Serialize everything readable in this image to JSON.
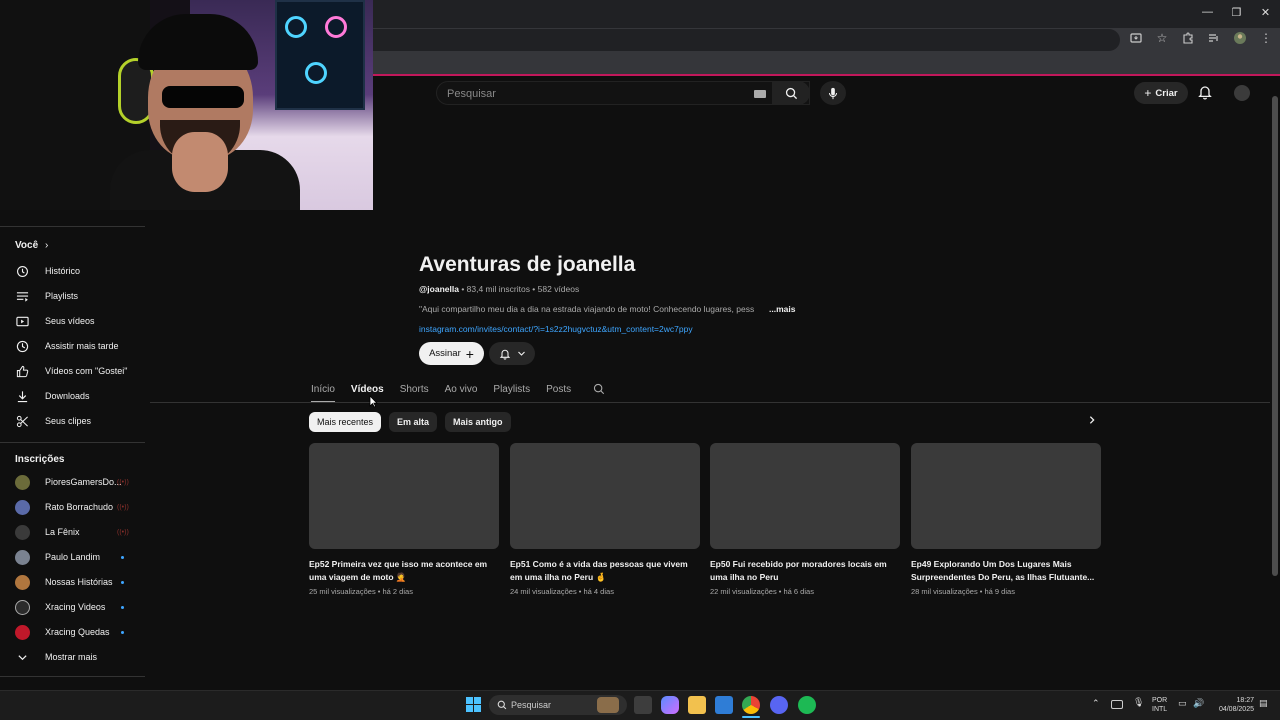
{
  "browser": {
    "minimize_glyph": "—",
    "restore_glyph": "❐",
    "close_glyph": "✕"
  },
  "header": {
    "search_placeholder": "Pesquisar",
    "create_label": "Criar"
  },
  "sidebar": {
    "you_heading": "Você",
    "you_items": [
      {
        "label": "Histórico",
        "icon": "history-icon"
      },
      {
        "label": "Playlists",
        "icon": "playlist-icon"
      },
      {
        "label": "Seus vídeos",
        "icon": "your-videos-icon"
      },
      {
        "label": "Assistir mais tarde",
        "icon": "watch-later-icon"
      },
      {
        "label": "Vídeos com \"Gostei\"",
        "icon": "like-icon"
      },
      {
        "label": "Downloads",
        "icon": "download-icon"
      },
      {
        "label": "Seus clipes",
        "icon": "clips-icon"
      }
    ],
    "subs_heading": "Inscrições",
    "subscriptions": [
      {
        "label": "PioresGamersDo...",
        "status": "live",
        "color": "#6b6b3a"
      },
      {
        "label": "Rato Borrachudo",
        "status": "live",
        "color": "#5a6aa8"
      },
      {
        "label": "La Fênix",
        "status": "live",
        "color": "#3a3a3a"
      },
      {
        "label": "Paulo Landim",
        "status": "new",
        "color": "#7a8290"
      },
      {
        "label": "Nossas Histórias",
        "status": "new",
        "color": "#b0763e"
      },
      {
        "label": "Xracing Videos",
        "status": "new",
        "color": "#2b2b2b"
      },
      {
        "label": "Xracing Quedas",
        "status": "new",
        "color": "#c0182a"
      }
    ],
    "show_more": "Mostrar mais"
  },
  "channel": {
    "name": "Aventuras de joanella",
    "handle": "@joanella",
    "meta_rest": " • 83,4 mil inscritos • 582 vídeos",
    "description": "\"Aqui compartilho meu dia a dia na estrada viajando de moto! Conhecendo lugares, pess",
    "more": "...mais",
    "link": "instagram.com/invites/contact/?i=1s2z2hugvctuz&utm_content=2wc7ppy",
    "subscribe_label": "Assinar"
  },
  "tabs": [
    "Início",
    "Vídeos",
    "Shorts",
    "Ao vivo",
    "Playlists",
    "Posts"
  ],
  "chips": [
    "Mais recentes",
    "Em alta",
    "Mais antigo"
  ],
  "videos": [
    {
      "title": "Ep52 Primeira vez que isso me acontece em uma viagem de moto 🤦",
      "views": "25 mil visualizações",
      "age": "há 2 dias"
    },
    {
      "title": "Ep51 Como é a vida das pessoas que vivem em uma ilha no Peru 🤞",
      "views": "24 mil visualizações",
      "age": "há 4 dias"
    },
    {
      "title": "Ep50 Fui recebido por moradores locais em uma ilha no Peru",
      "views": "22 mil visualizações",
      "age": "há 6 dias"
    },
    {
      "title": "Ep49 Explorando Um Dos Lugares Mais Surpreendentes Do Peru, as Ilhas Flutuante...",
      "views": "28 mil visualizações",
      "age": "há 9 dias"
    }
  ],
  "taskbar": {
    "search_label": "Pesquisar",
    "lang_line1": "POR",
    "lang_line2": "INTL",
    "time": "18:27",
    "date": "04/08/2025"
  }
}
